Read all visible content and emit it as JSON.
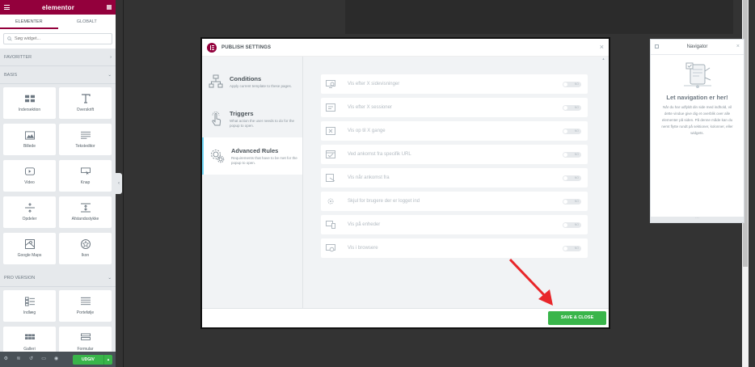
{
  "panel": {
    "brand": "elementor",
    "tabs": [
      "ELEMENTER",
      "GLOBALT"
    ],
    "search_placeholder": "Søg widget...",
    "categories": {
      "favorites": "FAVORITTER",
      "basic": "BASIS",
      "pro": "PRO VERSION"
    },
    "basic_widgets": [
      {
        "label": "Indersektion",
        "icon": "inner-section-icon"
      },
      {
        "label": "Overskrift",
        "icon": "heading-icon"
      },
      {
        "label": "Billede",
        "icon": "image-icon"
      },
      {
        "label": "Teksteditor",
        "icon": "text-editor-icon"
      },
      {
        "label": "Video",
        "icon": "video-icon"
      },
      {
        "label": "Knap",
        "icon": "button-icon"
      },
      {
        "label": "Opdeler",
        "icon": "divider-icon"
      },
      {
        "label": "Afstandsstykke",
        "icon": "spacer-icon"
      },
      {
        "label": "Google Maps",
        "icon": "google-maps-icon"
      },
      {
        "label": "Ikon",
        "icon": "star-icon"
      }
    ],
    "pro_widgets": [
      {
        "label": "Indlæg",
        "icon": "posts-icon"
      },
      {
        "label": "Portefølje",
        "icon": "portfolio-icon"
      },
      {
        "label": "Galleri",
        "icon": "gallery-icon"
      },
      {
        "label": "Formular",
        "icon": "form-icon"
      }
    ],
    "footer": {
      "publish_label": "UDGIV"
    }
  },
  "modal": {
    "title": "PUBLISH SETTINGS",
    "nav": [
      {
        "title": "Conditions",
        "desc": "Apply current template to these pages."
      },
      {
        "title": "Triggers",
        "desc": "What action the user needs to do for the popup to open."
      },
      {
        "title": "Advanced Rules",
        "desc": "Requirements that have to be met for the popup to open."
      }
    ],
    "rules": [
      {
        "label": "Vis efter X sidevisninger",
        "toggle": "NO"
      },
      {
        "label": "Vis efter X sessioner",
        "toggle": "NO"
      },
      {
        "label": "Vis op til X gange",
        "toggle": "NO"
      },
      {
        "label": "Ved ankomst fra specifik URL",
        "toggle": "NO"
      },
      {
        "label": "Vis når ankomst fra",
        "toggle": "NO"
      },
      {
        "label": "Skjul for brugere der er logget ind",
        "toggle": "NO"
      },
      {
        "label": "Vis på enheder",
        "toggle": "NO"
      },
      {
        "label": "Vis i browsere",
        "toggle": "NO"
      }
    ],
    "save_label": "SAVE & CLOSE"
  },
  "navigator": {
    "title": "Navigator",
    "heading": "Let navigation er her!",
    "description": "Når du har udfyldt din side med indhold, vil dette vindue give dig et overblik over alle elementer på siden. På denne måde kan du nemt flytte rundt på sektioner, kolonner, eller widgets."
  },
  "colors": {
    "brand": "#93003c",
    "publish": "#39b54a",
    "arrow": "#e8262a"
  }
}
